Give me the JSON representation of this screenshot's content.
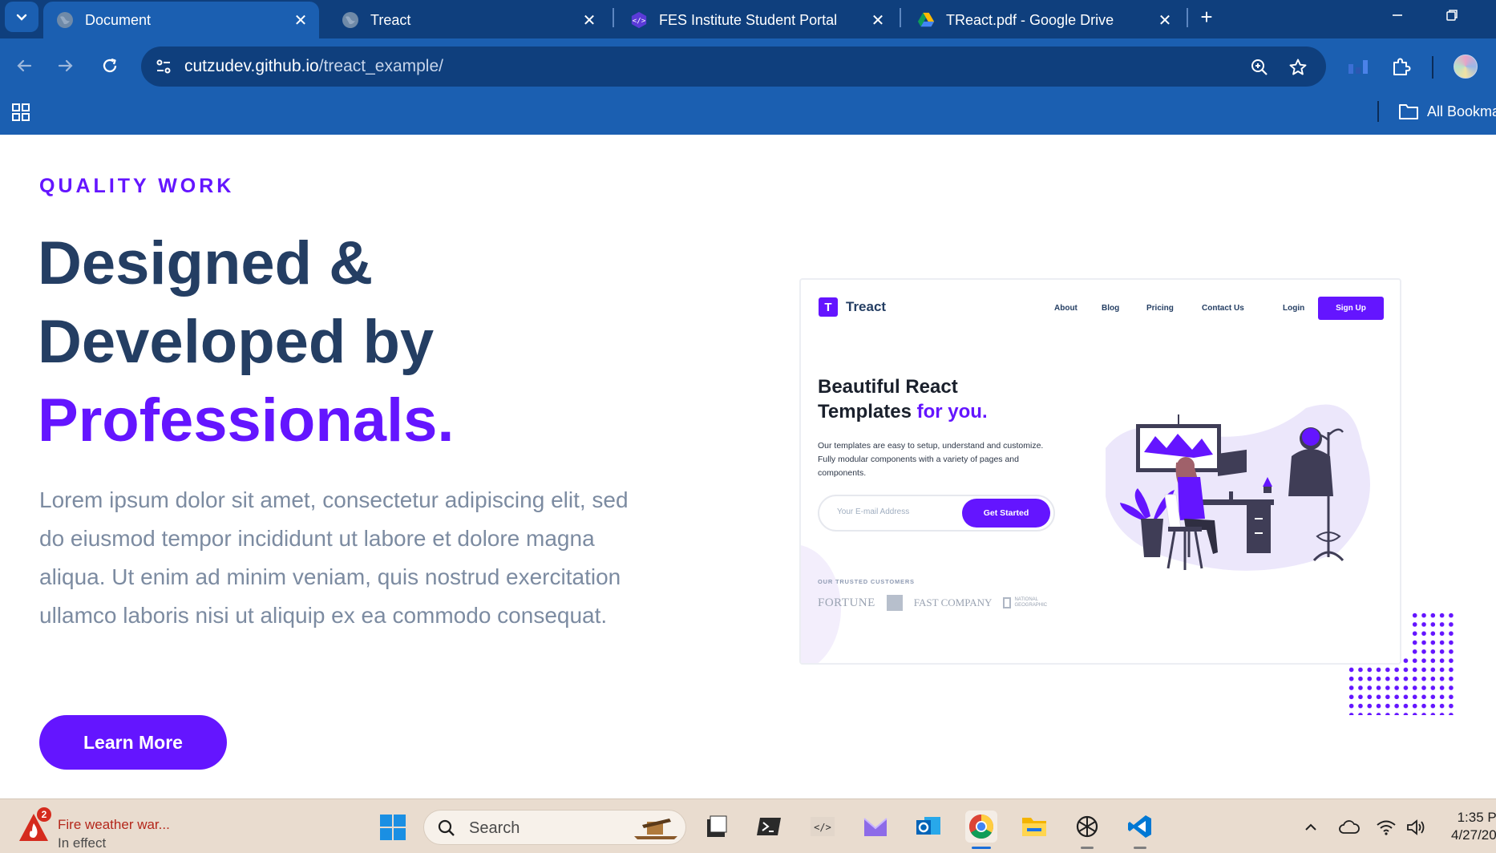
{
  "browser": {
    "tabs": [
      {
        "title": "Document",
        "favicon": "globe-icon",
        "active": true
      },
      {
        "title": "Treact",
        "favicon": "globe-icon",
        "active": false
      },
      {
        "title": "FES Institute Student Portal",
        "favicon": "code-icon",
        "active": false
      },
      {
        "title": "TReact.pdf - Google Drive",
        "favicon": "google-drive-icon",
        "active": false
      }
    ],
    "url_host": "cutzudev.github.io",
    "url_path": "/treact_example/",
    "bookmarks_label": "All Bookma"
  },
  "page": {
    "eyebrow": "QUALITY WORK",
    "headline_line1": "Designed &",
    "headline_line2": "Developed by",
    "headline_accent": "Professionals.",
    "lead": "Lorem ipsum dolor sit amet, consectetur adipiscing elit, sed do eiusmod tempor incididunt ut labore et dolore magna aliqua. Ut enim ad minim veniam, quis nostrud exercitation ullamco laboris nisi ut aliquip ex ea commodo consequat.",
    "cta_label": "Learn More",
    "accent_color": "#6415ff",
    "heading_color": "#243e63"
  },
  "preview": {
    "logo_letter": "T",
    "logo_text": "Treact",
    "nav": [
      "About",
      "Blog",
      "Pricing",
      "Contact Us"
    ],
    "login": "Login",
    "signup": "Sign Up",
    "heading_line1": "Beautiful React",
    "heading_line2": "Templates",
    "heading_accent": "for you.",
    "body": "Our templates are easy to setup, understand and customize. Fully modular components with a variety of pages and components.",
    "email_placeholder": "Your E-mail Address",
    "cta": "Get Started",
    "trusted_label": "OUR TRUSTED CUSTOMERS",
    "customer_logos": [
      "FORTUNE",
      "FAST COMPANY"
    ],
    "natgeo_text": "NATIONAL GEOGRAPHIC"
  },
  "taskbar": {
    "weather_badge": "2",
    "weather_title": "Fire weather war...",
    "weather_sub": "In effect",
    "search_label": "Search",
    "apps": [
      "file-explorer-dark-icon",
      "terminal-icon",
      "code-editor-icon",
      "mail-icon",
      "outlook-icon",
      "chrome-icon",
      "folder-icon",
      "chatgpt-icon",
      "vscode-icon"
    ],
    "clock_time": "1:35 P",
    "clock_date": "4/27/20"
  }
}
